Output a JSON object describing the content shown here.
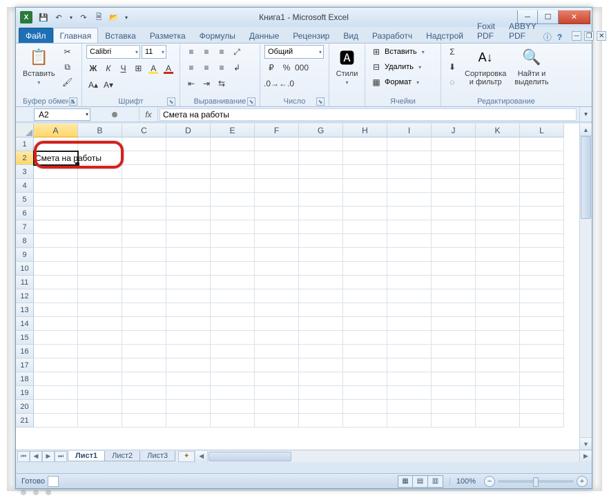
{
  "title": "Книга1  -  Microsoft Excel",
  "qat": {
    "save": "💾",
    "undo": "↶",
    "redo": "↷",
    "print": "🗎",
    "open": "📂"
  },
  "tabs": {
    "file": "Файл",
    "items": [
      "Главная",
      "Вставка",
      "Разметка",
      "Формулы",
      "Данные",
      "Рецензир",
      "Вид",
      "Разработч",
      "Надстрой",
      "Foxit PDF",
      "ABBYY PDF"
    ],
    "active_index": 0
  },
  "ribbon": {
    "clipboard": {
      "paste": "Вставить",
      "label": "Буфер обмена"
    },
    "font": {
      "name": "Calibri",
      "size": "11",
      "label": "Шрифт",
      "bold": "Ж",
      "italic": "К",
      "underline": "Ч"
    },
    "align": {
      "label": "Выравнивание"
    },
    "number": {
      "format": "Общий",
      "label": "Число"
    },
    "styles": {
      "btn": "Стили"
    },
    "cells": {
      "insert": "Вставить",
      "delete": "Удалить",
      "format": "Формат",
      "label": "Ячейки"
    },
    "editing": {
      "sort": "Сортировка\nи фильтр",
      "find": "Найти и\nвыделить",
      "label": "Редактирование"
    }
  },
  "fx": {
    "cell": "A2",
    "symbol": "fx",
    "value": "Смета на работы"
  },
  "columns": [
    "A",
    "B",
    "C",
    "D",
    "E",
    "F",
    "G",
    "H",
    "I",
    "J",
    "K",
    "L"
  ],
  "rows_count": 21,
  "active_row": 2,
  "cell_value": "Смета на работы",
  "sheets": {
    "items": [
      "Лист1",
      "Лист2",
      "Лист3"
    ],
    "active": 0
  },
  "status": {
    "ready": "Готово",
    "zoom": "100%"
  }
}
